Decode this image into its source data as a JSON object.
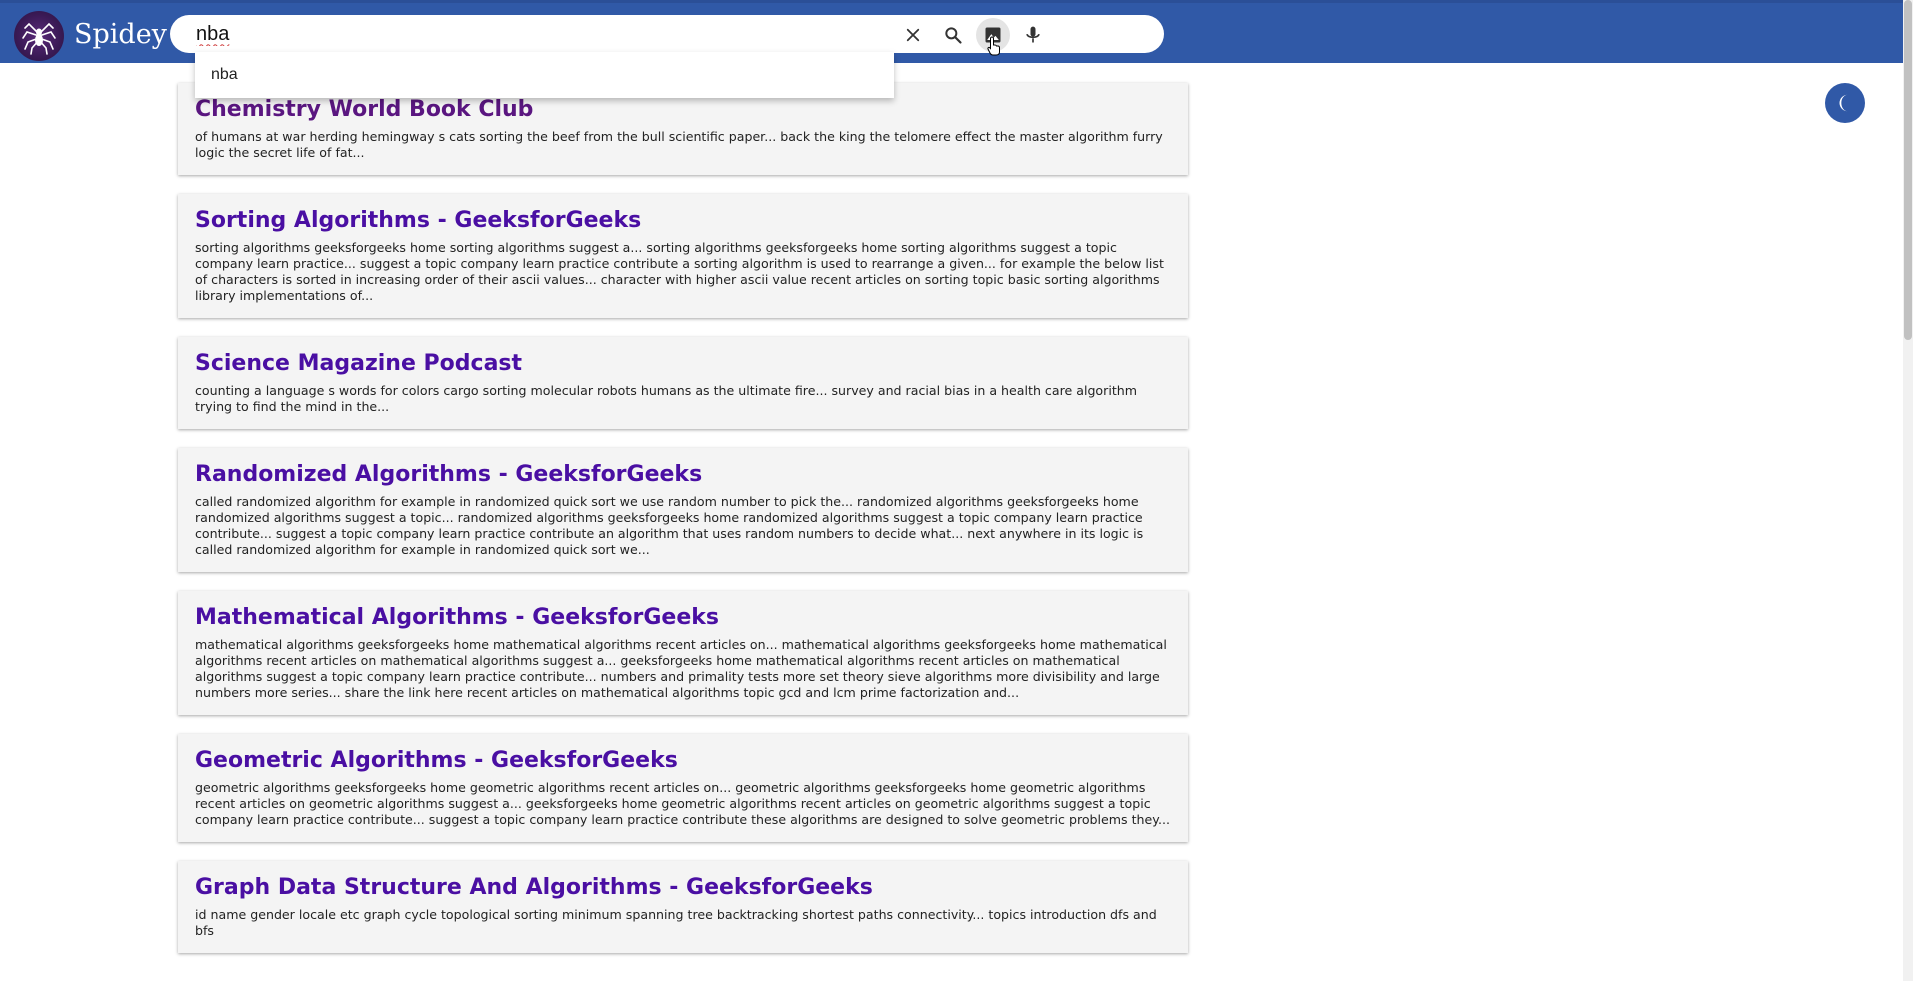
{
  "app": {
    "brand": "Spidey"
  },
  "search": {
    "query": "nba",
    "suggestions": [
      "nba"
    ]
  },
  "icons": {
    "logo": "spider-icon",
    "clear": "close-icon",
    "search": "search-icon",
    "image": "image-icon",
    "voice": "microphone-icon",
    "theme": "moon-icon"
  },
  "colors": {
    "header": "#3059a7",
    "title_link": "#4a0fa3",
    "title_visited": "#5a1680",
    "card_bg": "#f4f4f4"
  },
  "results": [
    {
      "title": "Chemistry World Book Club",
      "visited": true,
      "snippet": "of humans at war herding hemingway s cats sorting the beef from the bull scientific paper... back the king the telomere effect the master algorithm furry logic the secret life of fat..."
    },
    {
      "title": "Sorting Algorithms - GeeksforGeeks",
      "visited": false,
      "snippet": "sorting algorithms geeksforgeeks home sorting algorithms suggest a... sorting algorithms geeksforgeeks home sorting algorithms suggest a topic company learn practice... suggest a topic company learn practice contribute a sorting algorithm is used to rearrange a given... for example the below list of characters is sorted in increasing order of their ascii values... character with higher ascii value recent articles on sorting topic basic sorting algorithms library implementations of..."
    },
    {
      "title": "Science Magazine Podcast",
      "visited": false,
      "snippet": "counting a language s words for colors cargo sorting molecular robots humans as the ultimate fire... survey and racial bias in a health care algorithm trying to find the mind in the..."
    },
    {
      "title": "Randomized Algorithms - GeeksforGeeks",
      "visited": false,
      "snippet": "called randomized algorithm for example in randomized quick sort we use random number to pick the... randomized algorithms geeksforgeeks home randomized algorithms suggest a topic... randomized algorithms geeksforgeeks home randomized algorithms suggest a topic company learn practice contribute... suggest a topic company learn practice contribute an algorithm that uses random numbers to decide what... next anywhere in its logic is called randomized algorithm for example in randomized quick sort we..."
    },
    {
      "title": "Mathematical Algorithms - GeeksforGeeks",
      "visited": false,
      "snippet": "mathematical algorithms geeksforgeeks home mathematical algorithms recent articles on... mathematical algorithms geeksforgeeks home mathematical algorithms recent articles on mathematical algorithms suggest a... geeksforgeeks home mathematical algorithms recent articles on mathematical algorithms suggest a topic company learn practice contribute... numbers and primality tests more set theory sieve algorithms more divisibility and large numbers more series... share the link here recent articles on mathematical algorithms topic gcd and lcm prime factorization and..."
    },
    {
      "title": "Geometric Algorithms - GeeksforGeeks",
      "visited": false,
      "snippet": "geometric algorithms geeksforgeeks home geometric algorithms recent articles on... geometric algorithms geeksforgeeks home geometric algorithms recent articles on geometric algorithms suggest a... geeksforgeeks home geometric algorithms recent articles on geometric algorithms suggest a topic company learn practice contribute... suggest a topic company learn practice contribute these algorithms are designed to solve geometric problems they..."
    },
    {
      "title": "Graph Data Structure And Algorithms - GeeksforGeeks",
      "visited": false,
      "snippet": "id name gender locale etc graph cycle topological sorting minimum spanning tree backtracking shortest paths connectivity... topics introduction dfs and bfs"
    }
  ]
}
